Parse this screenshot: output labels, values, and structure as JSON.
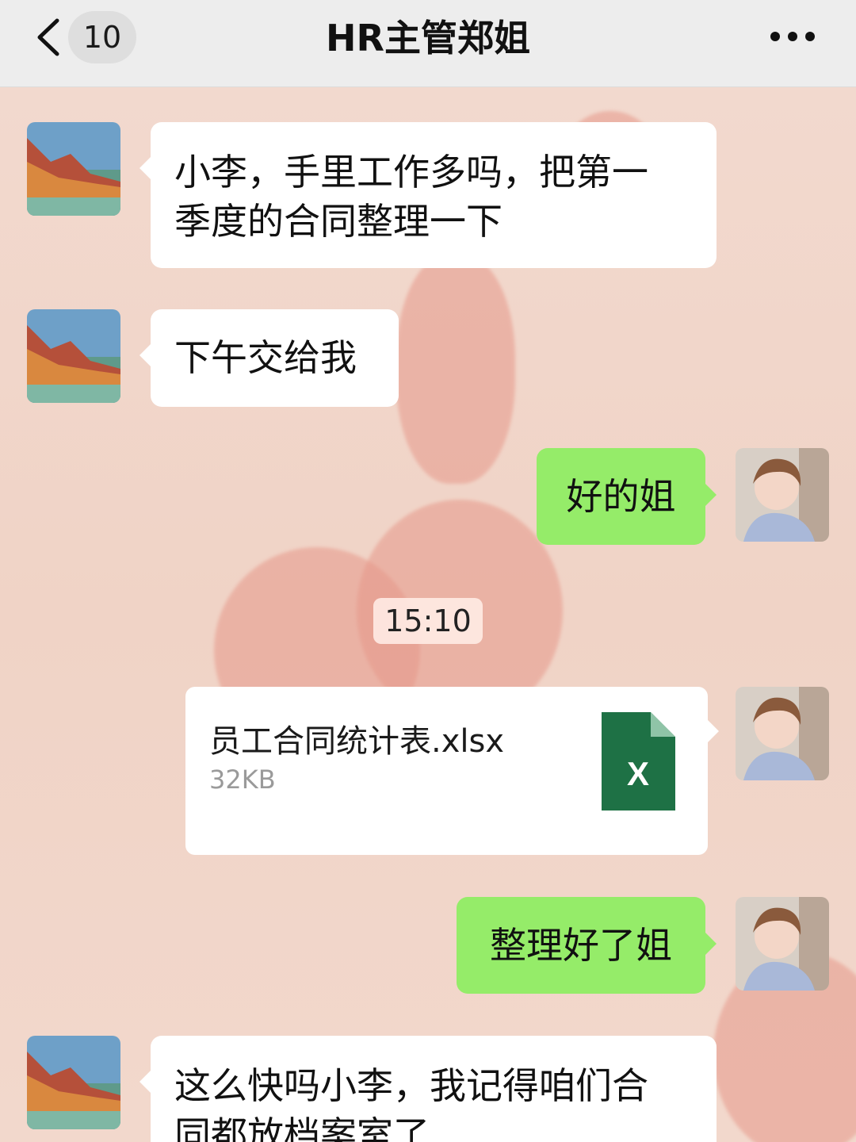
{
  "header": {
    "back_count": "10",
    "title": "HR主管郑姐"
  },
  "messages": {
    "m1": "小李，手里工作多吗，把第一季度的合同整理一下",
    "m1_l1": "小李，手里工作多吗，把第一",
    "m1_l2": "季度的合同整理一下",
    "m2": "下午交给我",
    "m3": "好的姐",
    "time": "15:10",
    "file_name": "员工合同统计表.xlsx",
    "file_size": "32KB",
    "file_icon_letter": "X",
    "m5": "整理好了姐",
    "m6_l1": "这么快吗小李，我记得咱们合",
    "m6_l2": "同都放档案室了"
  },
  "colors": {
    "sent_bubble": "#95ec69",
    "received_bubble": "#ffffff",
    "excel_green": "#1e7145"
  },
  "icons": {
    "back": "chevron-left-icon",
    "more": "more-dots-icon",
    "file": "excel-file-icon"
  }
}
